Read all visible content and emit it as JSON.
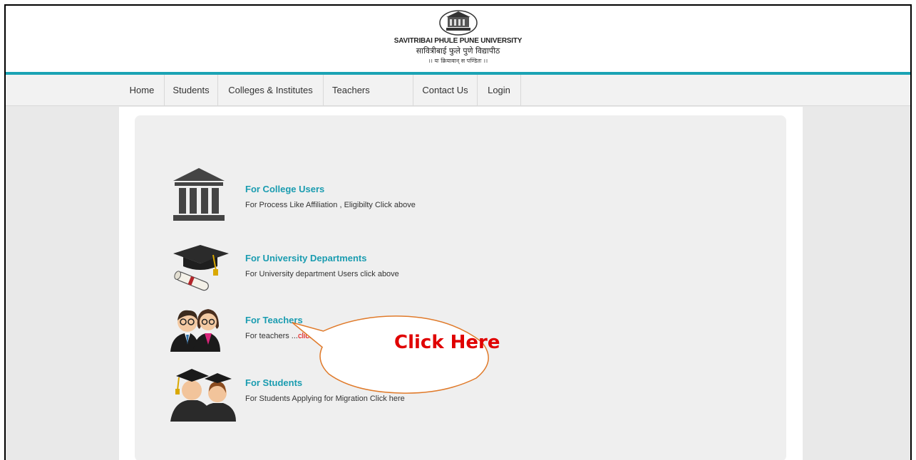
{
  "header": {
    "university_en": "SAVITRIBAI PHULE PUNE UNIVERSITY",
    "university_mr": "सावित्रीबाई फुले पुणे विद्यापीठ",
    "motto": "।। यः क्रियावान् स पण्डितः ।।"
  },
  "nav": {
    "items": [
      {
        "label": "Home"
      },
      {
        "label": "Students"
      },
      {
        "label": "Colleges & Institutes"
      },
      {
        "label": "Teachers"
      },
      {
        "label": "Contact Us"
      },
      {
        "label": "Login"
      }
    ]
  },
  "entries": [
    {
      "title": "For College Users",
      "desc": "For Process Like Affiliation , Eligibilty Click above",
      "icon": "building-icon"
    },
    {
      "title": "For University Departments",
      "desc": "For University department Users click above",
      "icon": "graduation-cap-icon"
    },
    {
      "title": "For Teachers",
      "desc_prefix": "For teachers ...",
      "desc_link": "click",
      "icon": "teachers-icon"
    },
    {
      "title": "For Students",
      "desc": "For Students Applying for Migration Click here",
      "icon": "students-icon"
    }
  ],
  "callout": {
    "text": "Click Here"
  },
  "colors": {
    "accent": "#1aa3b4",
    "link": "#1a9cb0",
    "callout_text": "#e00000",
    "callout_border": "#e07a2a"
  }
}
